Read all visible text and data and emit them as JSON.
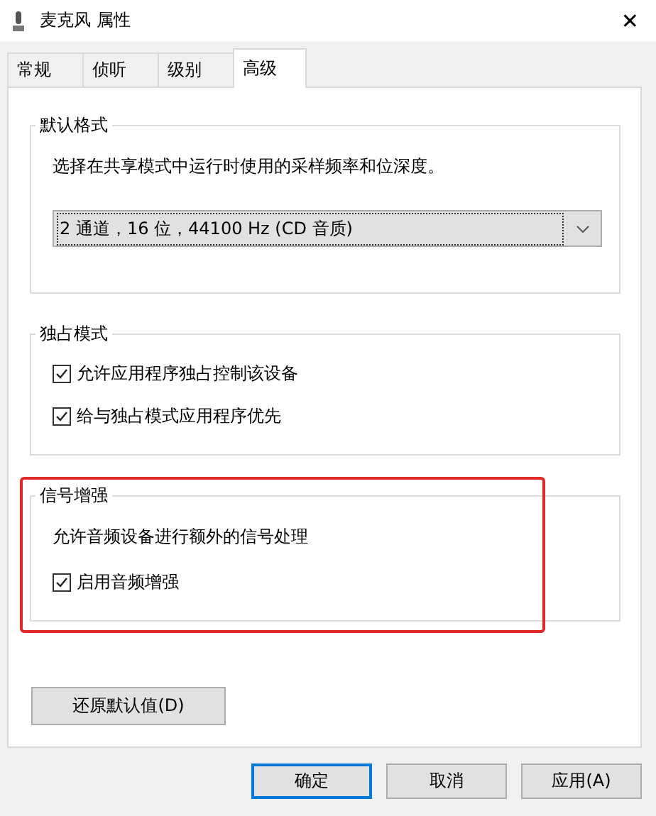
{
  "window": {
    "title": "麦克风 属性",
    "close": "✕"
  },
  "tabs": [
    {
      "label": "常规",
      "selected": false
    },
    {
      "label": "侦听",
      "selected": false
    },
    {
      "label": "级别",
      "selected": false
    },
    {
      "label": "高级",
      "selected": true
    }
  ],
  "groups": [
    {
      "title": "默认格式",
      "highlighted": false,
      "items": [
        {
          "kind": "text",
          "text": "选择在共享模式中运行时使用的采样频率和位深度。"
        },
        {
          "kind": "dropdown",
          "value": "2 通道，16 位，44100 Hz (CD 音质)"
        }
      ]
    },
    {
      "title": "独占模式",
      "highlighted": false,
      "items": [
        {
          "kind": "checkbox",
          "text": "允许应用程序独占控制该设备",
          "checked": true
        },
        {
          "kind": "checkbox",
          "text": "给与独占模式应用程序优先",
          "checked": true
        }
      ]
    },
    {
      "title": "信号增强",
      "highlighted": true,
      "items": [
        {
          "kind": "text",
          "text": "允许音频设备进行额外的信号处理"
        },
        {
          "kind": "checkbox",
          "text": "启用音频增强",
          "checked": true
        }
      ]
    }
  ],
  "restore_button": "还原默认值(D)",
  "buttons": [
    {
      "label": "确定",
      "default": true
    },
    {
      "label": "取消",
      "default": false
    },
    {
      "label": "应用(A)",
      "default": false
    }
  ]
}
